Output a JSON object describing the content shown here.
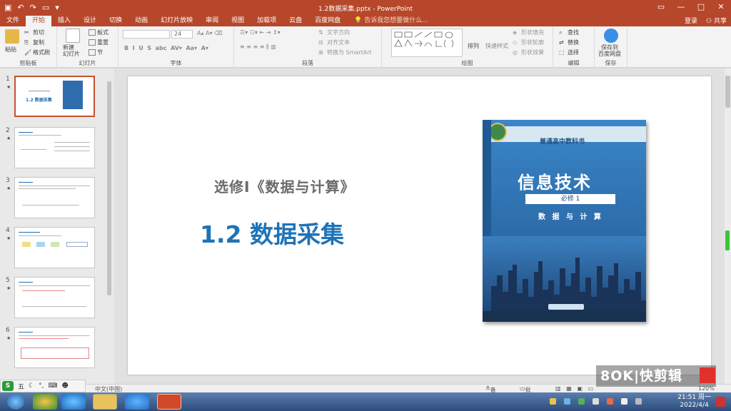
{
  "window": {
    "title": "1.2数据采集.pptx - PowerPoint",
    "controls": [
      "▭",
      "—",
      "□",
      "✕"
    ]
  },
  "tabs": {
    "items": [
      "文件",
      "开始",
      "插入",
      "设计",
      "切换",
      "动画",
      "幻灯片放映",
      "审阅",
      "视图",
      "加载项",
      "云盘",
      "百度网盘"
    ],
    "active": "开始",
    "search": "告诉我您想要做什么...",
    "login": "登录",
    "share": "共享"
  },
  "ribbon": {
    "clipboard": {
      "label": "剪贴板",
      "paste": "粘贴",
      "cut": "剪切",
      "copy": "复制",
      "format_painter": "格式刷"
    },
    "slides": {
      "label": "幻灯片",
      "new_slide": "新建\n幻灯片",
      "layout": "板式",
      "reset": "重置",
      "section": "节"
    },
    "font": {
      "label": "字体",
      "font_name": "",
      "font_size": "24"
    },
    "paragraph": {
      "label": "段落",
      "text_direction": "文字方向",
      "align_text": "对齐文本",
      "smartart": "转换为 SmartArt"
    },
    "drawing": {
      "label": "绘图",
      "arrange": "排列",
      "quick_styles": "快速样式",
      "fill": "形状填充",
      "outline": "形状轮廓",
      "effects": "形状效果"
    },
    "editing": {
      "label": "编辑",
      "find": "查找",
      "replace": "替换",
      "select": "选择"
    },
    "save": {
      "label": "保存",
      "save_baidu": "保存到\n百度网盘"
    }
  },
  "slides_panel": {
    "thumbnails": [
      {
        "num": "1",
        "title": "1.2 数据采集"
      },
      {
        "num": "2",
        "title": ""
      },
      {
        "num": "3",
        "title": ""
      },
      {
        "num": "4",
        "title": ""
      },
      {
        "num": "5",
        "title": ""
      },
      {
        "num": "6",
        "title": ""
      }
    ]
  },
  "slide": {
    "subtitle": "选修Ⅰ《数据与计算》",
    "title": "1.2  数据采集",
    "book": {
      "series": "普通高中教科书",
      "main_title": "信息技术",
      "volume": "必修 1",
      "subtitle": "数 据 与 计 算"
    }
  },
  "statusbar": {
    "language": "中文(中国)",
    "notes": "备注",
    "comments": "批注",
    "zoom": "120%"
  },
  "ime": {
    "label": "五"
  },
  "watermark": {
    "text": "8OK|快剪辑"
  },
  "taskbar": {
    "time": "21:51 周一",
    "date": "2022/4/4"
  },
  "colors": {
    "brand": "#b7472a",
    "title_blue": "#1e73b7",
    "book_blue": "#2f6dad"
  }
}
